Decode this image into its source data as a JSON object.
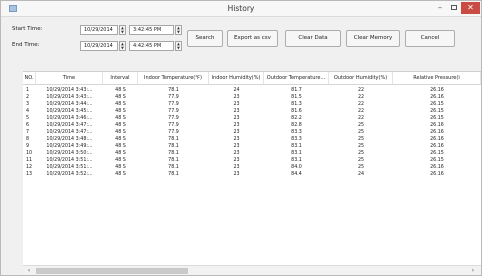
{
  "window": {
    "title": "History"
  },
  "filters": {
    "start_label": "Start Time:",
    "end_label": "End Time:",
    "start_date": "10/29/2014",
    "start_time": "3:42:45 PM",
    "end_date": "10/29/2014",
    "end_time": "4:42:45 PM"
  },
  "toolbar": {
    "search": "Search",
    "export": "Export as csv",
    "clear_data": "Clear Data",
    "clear_memory": "Clear Memory",
    "cancel": "Cancel"
  },
  "table": {
    "columns": [
      "NO.",
      "Time",
      "Interval",
      "Indoor Temperature(℉)",
      "Indoor Humidity(%)",
      "Outdoor Temperature...",
      "Outdoor Humidity(%)",
      "Relative Pressure(i"
    ],
    "rows": [
      [
        "1",
        "10/29/2014 3:43:...",
        "48 S",
        "78.1",
        "24",
        "81.7",
        "22",
        "26.16"
      ],
      [
        "2",
        "10/29/2014 3:43:...",
        "48 S",
        "77.9",
        "23",
        "81.5",
        "22",
        "26.16"
      ],
      [
        "3",
        "10/29/2014 3:44:...",
        "48 S",
        "77.9",
        "23",
        "81.3",
        "22",
        "26.15"
      ],
      [
        "4",
        "10/29/2014 3:45:...",
        "48 S",
        "77.9",
        "23",
        "81.6",
        "22",
        "26.15"
      ],
      [
        "5",
        "10/29/2014 3:46:...",
        "48 S",
        "77.9",
        "23",
        "82.2",
        "22",
        "26.15"
      ],
      [
        "6",
        "10/29/2014 3:47:...",
        "48 S",
        "77.9",
        "23",
        "82.8",
        "25",
        "26.16"
      ],
      [
        "7",
        "10/29/2014 3:47:...",
        "48 S",
        "77.9",
        "23",
        "83.3",
        "25",
        "26.16"
      ],
      [
        "8",
        "10/29/2014 3:48:...",
        "48 S",
        "78.1",
        "23",
        "83.3",
        "25",
        "26.16"
      ],
      [
        "9",
        "10/29/2014 3:49:...",
        "48 S",
        "78.1",
        "23",
        "83.1",
        "25",
        "26.16"
      ],
      [
        "10",
        "10/29/2014 3:50:...",
        "48 S",
        "78.1",
        "23",
        "83.1",
        "25",
        "26.15"
      ],
      [
        "11",
        "10/29/2014 3:51:...",
        "48 S",
        "78.1",
        "23",
        "83.1",
        "25",
        "26.15"
      ],
      [
        "12",
        "10/29/2014 3:51:...",
        "48 S",
        "78.1",
        "23",
        "84.0",
        "25",
        "26.16"
      ],
      [
        "13",
        "10/29/2014 3:52:...",
        "48 S",
        "78.1",
        "23",
        "84.4",
        "24",
        "26.16"
      ]
    ]
  },
  "icons": {
    "app": "weather-app-icon",
    "minimize": "minimize-icon",
    "maximize": "maximize-icon",
    "close": "close-icon",
    "scroll_left": "chevron-left-icon",
    "scroll_right": "chevron-right-icon"
  },
  "colors": {
    "close_button": "#c94b44"
  }
}
